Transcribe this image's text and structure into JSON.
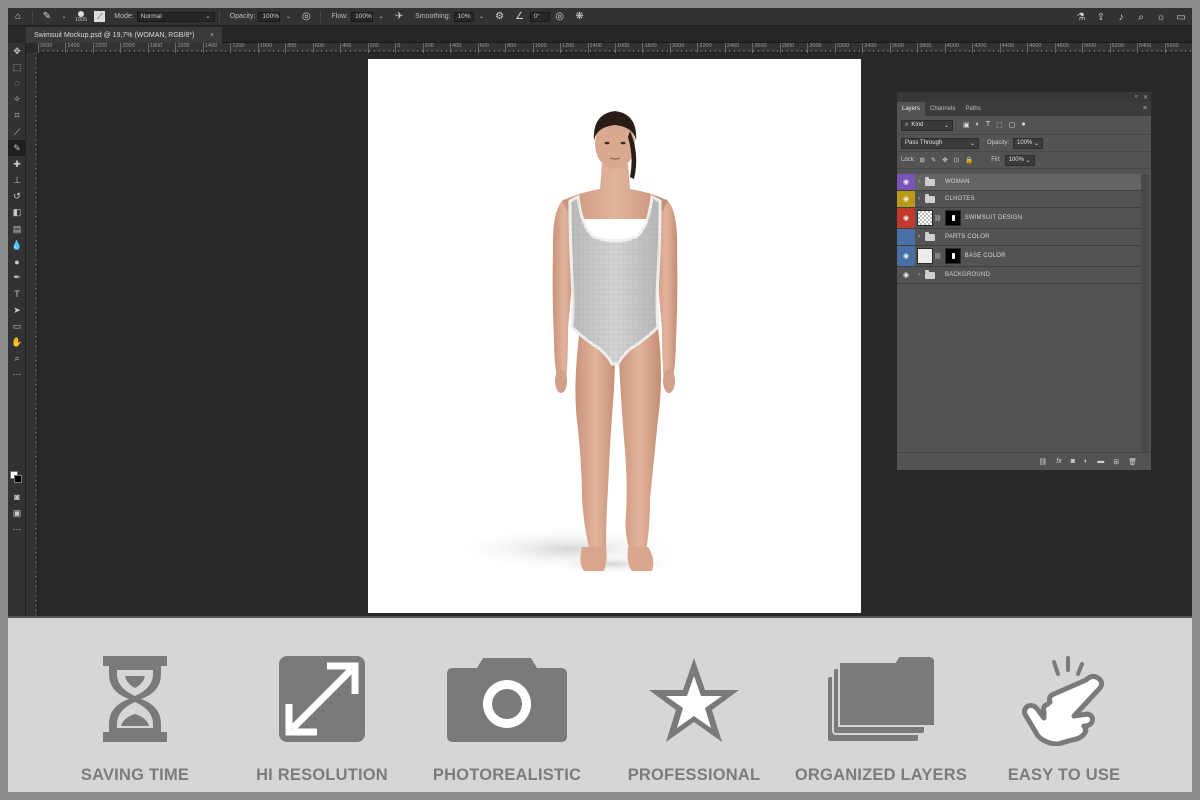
{
  "options_bar": {
    "brush_size": "1805",
    "mode_label": "Mode:",
    "mode_value": "Normal",
    "opacity_label": "Opacity:",
    "opacity_value": "100%",
    "flow_label": "Flow:",
    "flow_value": "100%",
    "smoothing_label": "Smoothing:",
    "smoothing_value": "10%",
    "angle_value": "0°"
  },
  "document_tab": {
    "title": "Swimsuit Mockup.psd @ 19,7% (WOMAN, RGB/8*)",
    "close": "×"
  },
  "ruler": {
    "ticks": [
      "2600",
      "2400",
      "2200",
      "2000",
      "1800",
      "1600",
      "1400",
      "1200",
      "1000",
      "800",
      "600",
      "400",
      "200",
      "0",
      "200",
      "400",
      "600",
      "800",
      "1000",
      "1200",
      "1400",
      "1600",
      "1800",
      "2000",
      "2200",
      "2400",
      "2600",
      "2800",
      "3000",
      "3200",
      "3400",
      "3600",
      "3800",
      "4000",
      "4200",
      "4400",
      "4600",
      "4800",
      "5000",
      "5200",
      "5400",
      "5600"
    ]
  },
  "layers_panel": {
    "tabs": [
      "Layers",
      "Channels",
      "Paths"
    ],
    "kind_label": "Kind",
    "blend_mode": "Pass Through",
    "opacity_label": "Opacity:",
    "opacity_value": "100%",
    "lock_label": "Lock:",
    "fill_label": "Fill:",
    "fill_value": "100%",
    "layers": [
      {
        "name": "WOMAN",
        "tag_color": "#7a54b8",
        "type": "group",
        "visible": true,
        "selected": true
      },
      {
        "name": "CLHOTES",
        "tag_color": "#b89a16",
        "type": "group",
        "visible": true,
        "selected": false
      },
      {
        "name": "SWIMSUIT DESIGN",
        "tag_color": "#c0392b",
        "type": "smart",
        "visible": true,
        "selected": false
      },
      {
        "name": "PARTS COLOR",
        "tag_color": "#4a6fa5",
        "type": "group",
        "visible": false,
        "selected": false
      },
      {
        "name": "BASE COLOR",
        "tag_color": "#4a6fa5",
        "type": "fill",
        "visible": true,
        "selected": false
      },
      {
        "name": "BACKGROUND",
        "tag_color": "",
        "type": "group",
        "visible": true,
        "selected": false
      }
    ]
  },
  "features": [
    {
      "label": "SAVING TIME",
      "icon": "hourglass-icon"
    },
    {
      "label": "HI RESOLUTION",
      "icon": "expand-arrows-icon"
    },
    {
      "label": "PHOTOREALISTIC",
      "icon": "camera-icon"
    },
    {
      "label": "PROFESSIONAL",
      "icon": "star-icon"
    },
    {
      "label": "ORGANIZED LAYERS",
      "icon": "stacked-folders-icon"
    },
    {
      "label": "EASY TO USE",
      "icon": "pointing-hand-icon"
    }
  ],
  "colors": {
    "feature_icon": "#7a7a7a",
    "feature_bg": "#d6d6d6",
    "swimsuit": "#c9c9c9"
  }
}
